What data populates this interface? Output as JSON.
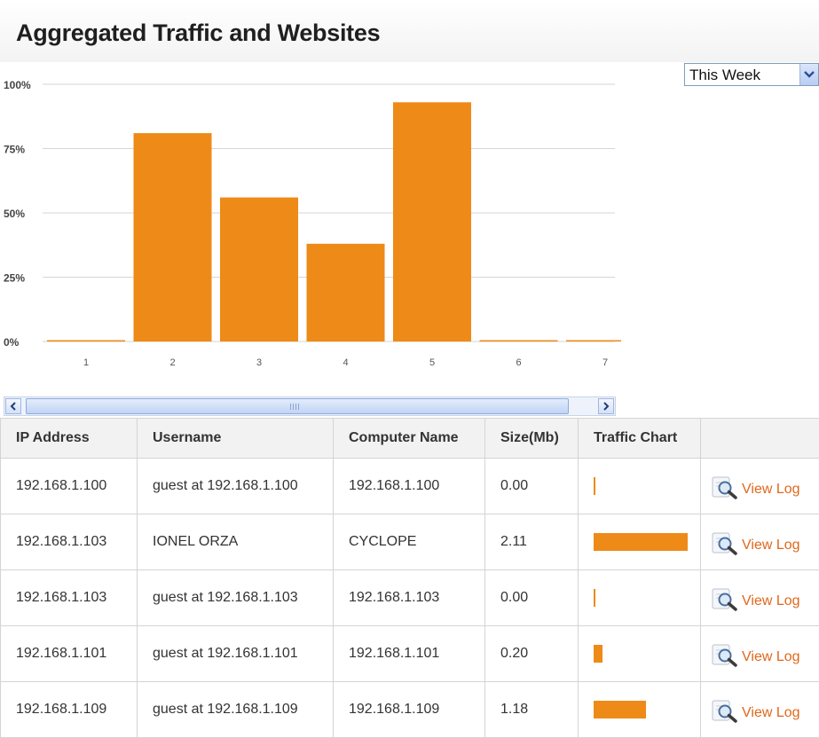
{
  "title": "Aggregated Traffic and Websites",
  "period_select": {
    "value": "This Week"
  },
  "chart_data": {
    "type": "bar",
    "title": "",
    "xlabel": "",
    "ylabel": "",
    "categories": [
      "1",
      "2",
      "3",
      "4",
      "5",
      "6",
      "7"
    ],
    "values": [
      0,
      81,
      56,
      38,
      93,
      0,
      0
    ],
    "ylim": [
      0,
      100
    ],
    "yticks": [
      0,
      25,
      50,
      75,
      100
    ],
    "ytick_labels": [
      "0%",
      "25%",
      "50%",
      "75%",
      "100%"
    ],
    "grid": true,
    "bar_color": "#ee8a17"
  },
  "table": {
    "columns": [
      "IP Address",
      "Username",
      "Computer Name",
      "Size(Mb)",
      "Traffic Chart",
      ""
    ],
    "rows": [
      {
        "ip": "192.168.1.100",
        "username": "guest at 192.168.1.100",
        "computer": "192.168.1.100",
        "size": "0.00",
        "traffic": 0.0,
        "action": "View Log"
      },
      {
        "ip": "192.168.1.103",
        "username": "IONEL ORZA",
        "computer": "CYCLOPE",
        "size": "2.11",
        "traffic": 1.0,
        "action": "View Log"
      },
      {
        "ip": "192.168.1.103",
        "username": "guest at 192.168.1.103",
        "computer": "192.168.1.103",
        "size": "0.00",
        "traffic": 0.0,
        "action": "View Log"
      },
      {
        "ip": "192.168.1.101",
        "username": "guest at 192.168.1.101",
        "computer": "192.168.1.101",
        "size": "0.20",
        "traffic": 0.095,
        "action": "View Log"
      },
      {
        "ip": "192.168.1.109",
        "username": "guest at 192.168.1.109",
        "computer": "192.168.1.109",
        "size": "1.18",
        "traffic": 0.56,
        "action": "View Log"
      }
    ]
  },
  "colors": {
    "accent": "#ee8a17",
    "link": "#e0671b"
  },
  "icons": {
    "view_log": "magnifier-icon",
    "dropdown": "chevron-down-icon",
    "scroll_left": "arrow-left-icon",
    "scroll_right": "arrow-right-icon"
  }
}
